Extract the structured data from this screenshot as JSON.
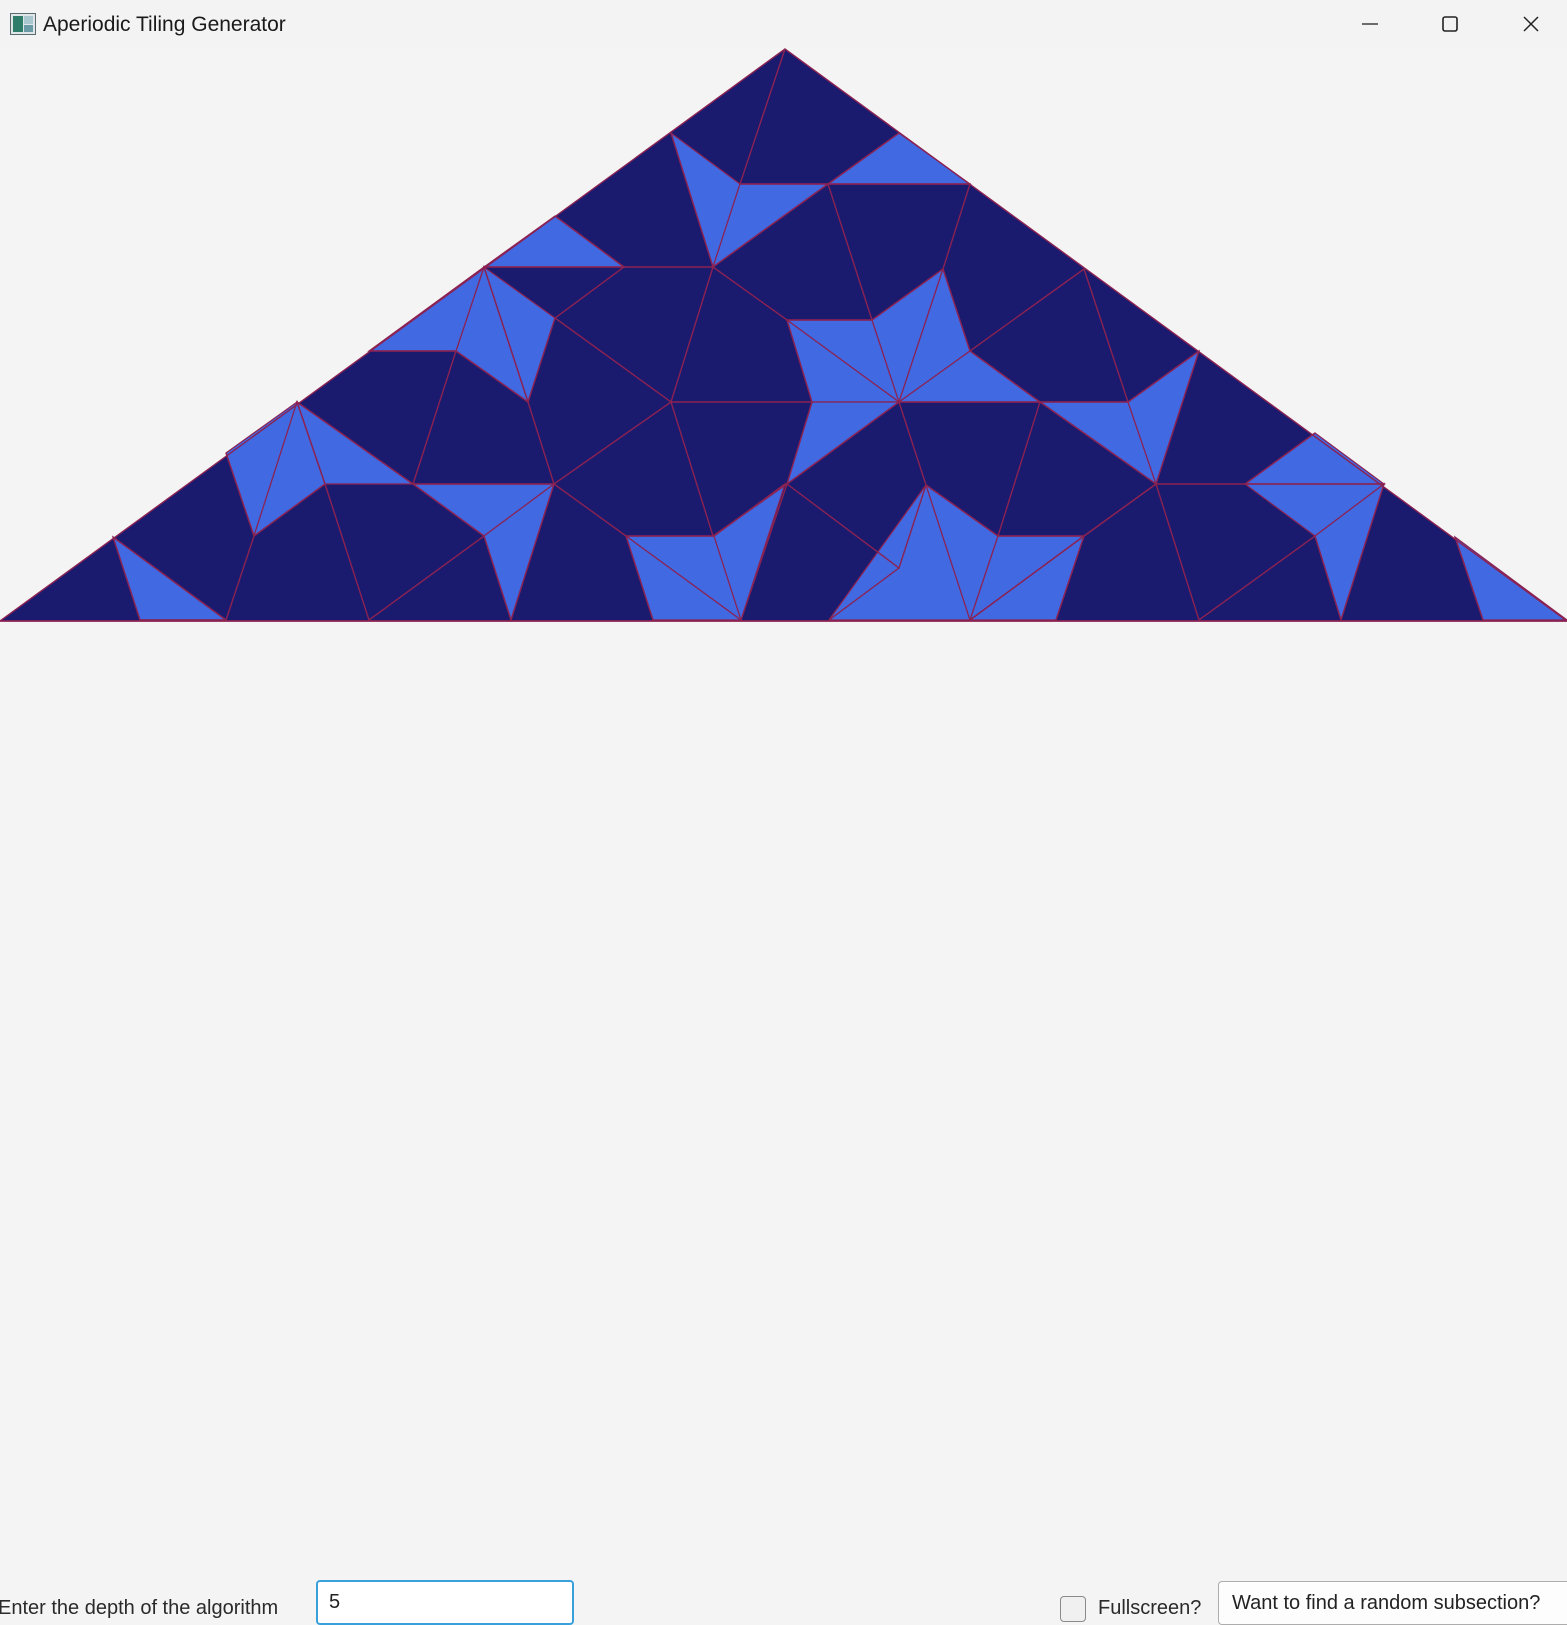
{
  "window": {
    "title": "Aperiodic Tiling Generator",
    "controls": [
      "minimize",
      "maximize",
      "close"
    ]
  },
  "tiling": {
    "colors": {
      "dark_tile": "#1a1a6e",
      "light_tile": "#4169e1",
      "edge": "#8b2252",
      "background": "#f4f4f4"
    }
  },
  "controls": {
    "depth_label": "Enter the depth of the algorithm",
    "depth_value": "5",
    "fullscreen_label": "Fullscreen?",
    "fullscreen_checked": false,
    "subsection_button_label": "Want to find a random subsection?"
  }
}
